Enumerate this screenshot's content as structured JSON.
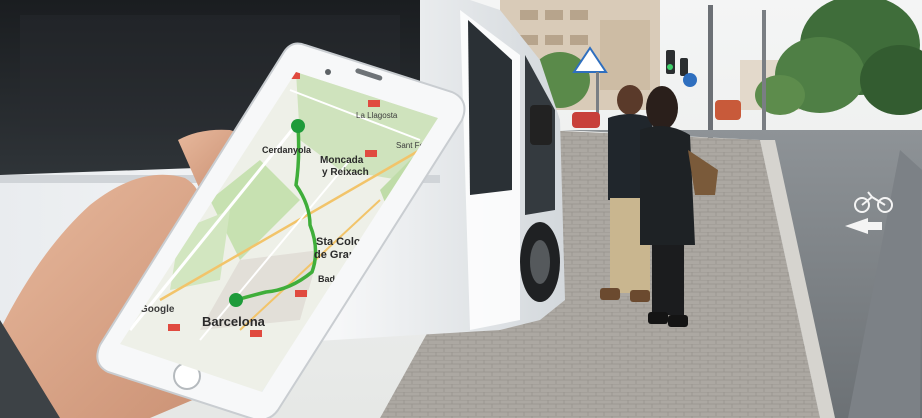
{
  "map": {
    "towns": {
      "badalona": "Badalona",
      "santa_coloma": "Sta Coloma",
      "de_gramenet": "de Gramenet",
      "barcelona": "Barcelona",
      "montcada": "Moncada",
      "reixach": "y Reixach",
      "cerdanyola": "Cerdanyola",
      "la_llagosta": "La Llagosta",
      "sant_fost": "Sant Fost"
    },
    "logo": "Google",
    "route_color": "#3fae3a",
    "marker_color": "#1e9b3a"
  }
}
